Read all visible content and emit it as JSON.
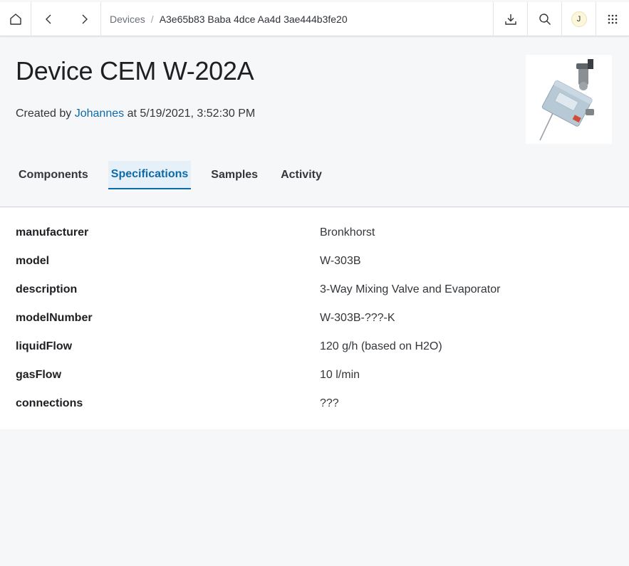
{
  "nav": {
    "breadcrumbs": [
      "Devices",
      "A3e65b83 Baba 4dce Aa4d 3ae444b3fe20"
    ],
    "separator": "/",
    "user_initial": "J",
    "icons": [
      "home-icon",
      "back-icon",
      "forward-icon",
      "download-icon",
      "search-icon",
      "apps-grid-icon"
    ]
  },
  "header": {
    "title": "Device CEM W-202A",
    "created_prefix": "Created by",
    "created_user": "Johannes",
    "created_suffix": "at 5/19/2021, 3:52:30 PM"
  },
  "tabs": [
    {
      "label": "Components",
      "active": false
    },
    {
      "label": "Specifications",
      "active": true
    },
    {
      "label": "Samples",
      "active": false
    },
    {
      "label": "Activity",
      "active": false
    }
  ],
  "specifications": [
    {
      "key": "manufacturer",
      "value": "Bronkhorst"
    },
    {
      "key": "model",
      "value": "W-303B"
    },
    {
      "key": "description",
      "value": "3-Way Mixing Valve and Evaporator"
    },
    {
      "key": "modelNumber",
      "value": "W-303B-???-K"
    },
    {
      "key": "liquidFlow",
      "value": "120 g/h (based on H2O)"
    },
    {
      "key": "gasFlow",
      "value": "10 l/min"
    },
    {
      "key": "connections",
      "value": "???"
    }
  ],
  "colors": {
    "accent": "#0e6aa8",
    "active_tab_bg": "#e6f0f8",
    "page_bg": "#f6f7f9"
  }
}
